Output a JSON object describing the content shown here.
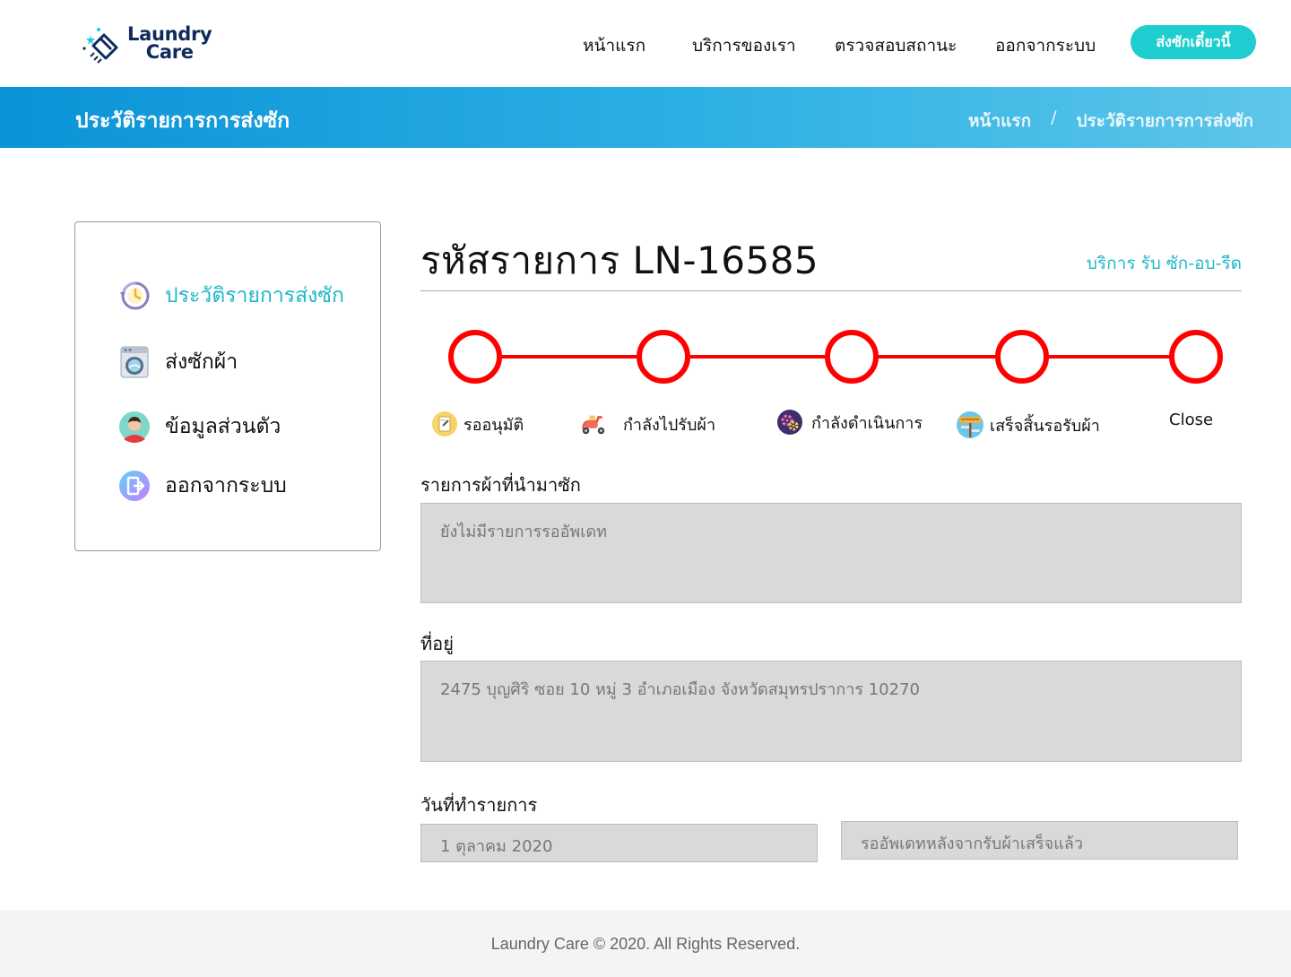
{
  "header": {
    "logo": {
      "line1": "Laundry",
      "line2": "Care"
    },
    "nav": [
      "หน้าแรก",
      "บริการของเรา",
      "ตรวจสอบสถานะ",
      "ออกจากระบบ"
    ],
    "cta_label": "ส่งซักเดี๋ยวนี้"
  },
  "banner": {
    "title": "ประวัติรายการการส่งซัก",
    "breadcrumb": {
      "home": "หน้าแรก",
      "separator": "/",
      "current": "ประวัติรายการการส่งซัก"
    }
  },
  "sidebar": {
    "items": [
      {
        "label": "ประวัติรายการส่งซัก",
        "icon": "history-icon",
        "active": true
      },
      {
        "label": "ส่งซักผ้า",
        "icon": "washing-machine-icon",
        "active": false
      },
      {
        "label": "ข้อมูลส่วนตัว",
        "icon": "user-avatar-icon",
        "active": false
      },
      {
        "label": "ออกจากระบบ",
        "icon": "logout-icon",
        "active": false
      }
    ]
  },
  "order": {
    "title": "รหัสรายการ LN-16585",
    "service": "บริการ รับ ซัก-อบ-รีด"
  },
  "tracker": {
    "line_color": "#ff0000",
    "steps": [
      {
        "label": "รออนุมัติ",
        "icon": "document-icon"
      },
      {
        "label": "กำลังไปรับผ้า",
        "icon": "scooter-icon"
      },
      {
        "label": "กำลังดำเนินการ",
        "icon": "gears-icon"
      },
      {
        "label": "เสร็จสิ้นรอรับผ้า",
        "icon": "success-sign-icon"
      },
      {
        "label": "Close",
        "icon": ""
      }
    ]
  },
  "fields": {
    "items_label": "รายการผ้าที่นำมาซัก",
    "items_value": "ยังไม่มีรายการรออัพเดท",
    "address_label": "ที่อยู่",
    "address_value": "2475 บุญศิริ ซอย 10 หมู่ 3 อำเภอเมือง จังหวัดสมุทรปราการ 10270",
    "date_label": "วันที่ทำรายการ",
    "date_value": "1 ตุลาคม 2020",
    "status_value": "รออัพเดทหลังจากรับผ้าเสร็จแล้ว"
  },
  "footer": {
    "text": "Laundry Care © 2020. All Rights Reserved."
  },
  "colors": {
    "accent": "#1ecdd0",
    "banner_start": "#0a93d8",
    "banner_end": "#5ec6ea",
    "link": "#1eb7c9",
    "field_bg": "#d9d9d9"
  }
}
